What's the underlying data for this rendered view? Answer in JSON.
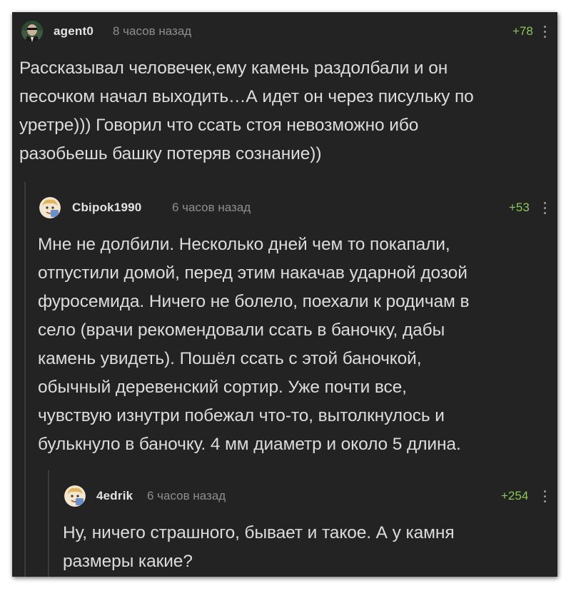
{
  "comments": [
    {
      "user": "agent0",
      "time": "8 часов назад",
      "rating": "+78",
      "avatar_icon": "agent-smith-avatar-icon",
      "lines": [
        "Рассказывал человечек,ему камень раздолбали и он",
        "песочком начал выходить…А идет он через писульку по",
        "уретре))) Говорил что ссать стоя невозможно ибо",
        "разобьешь башку потеряв сознание))"
      ]
    },
    {
      "user": "Cbipok1990",
      "time": "6 часов назад",
      "rating": "+53",
      "avatar_icon": "cartoon-face-avatar-icon",
      "lines": [
        "Мне не долбили. Несколько дней чем то покапали,",
        "отпустили домой, перед этим накачав ударной дозой",
        "фуросемида. Ничего не болело, поехали к родичам в",
        "село (врачи рекомендовали ссать в баночку, дабы",
        "камень увидеть). Пошёл ссать с этой баночкой,",
        "обычный деревенский сортир. Уже почти все,",
        "чувствую изнутри побежал что-то, вытолкнулось и",
        "булькнуло в баночку. 4 мм диаметр и около 5 длина."
      ]
    },
    {
      "user": "4edrik",
      "time": "6 часов назад",
      "rating": "+254",
      "avatar_icon": "cartoon-face-avatar-icon",
      "lines": [
        "Ну, ничего страшного, бывает и такое. А у камня",
        "размеры какие?"
      ]
    }
  ]
}
